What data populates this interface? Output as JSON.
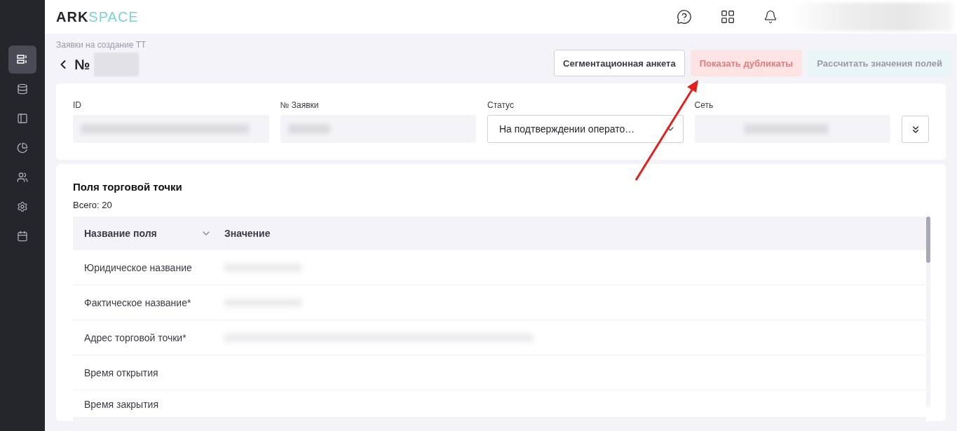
{
  "logo": {
    "part_1": "ARK",
    "part_2": "SPACE"
  },
  "sidebar": {
    "items": [
      {
        "selected": true
      },
      {
        "selected": false
      },
      {
        "selected": false
      },
      {
        "selected": false
      },
      {
        "selected": false
      },
      {
        "selected": false
      },
      {
        "selected": false
      }
    ]
  },
  "breadcrumb": "Заявки на создание ТТ",
  "title": "№",
  "buttons": [
    {
      "label": "Сегментационная анкета",
      "kind": "outline",
      "disabled": false
    },
    {
      "label": "Показать дубликаты",
      "kind": "danger",
      "disabled": true
    },
    {
      "label": "Рассчитать значения полей",
      "kind": "accent",
      "disabled": true
    }
  ],
  "fields": [
    {
      "label": "ID",
      "kind": "text",
      "redacted": true
    },
    {
      "label": "№ Заявки",
      "kind": "text",
      "redacted": true
    },
    {
      "label": "Статус",
      "kind": "select",
      "value": "На подтверждении операто…"
    },
    {
      "label": "Сеть",
      "kind": "text",
      "redacted": true
    }
  ],
  "section": {
    "title": "Поля торговой точки",
    "count": "Всего: 20"
  },
  "table": {
    "columns": [
      "Название поля",
      "Значение"
    ],
    "rows": [
      {
        "name": "Юридическое название",
        "value_redacted": true
      },
      {
        "name": "Фактическое название*",
        "value_redacted": true
      },
      {
        "name": "Адрес торговой точки*",
        "value_redacted": true
      },
      {
        "name": "Время открытия",
        "value_redacted": false
      },
      {
        "name": "Время закрытия",
        "value_redacted": false
      }
    ]
  }
}
